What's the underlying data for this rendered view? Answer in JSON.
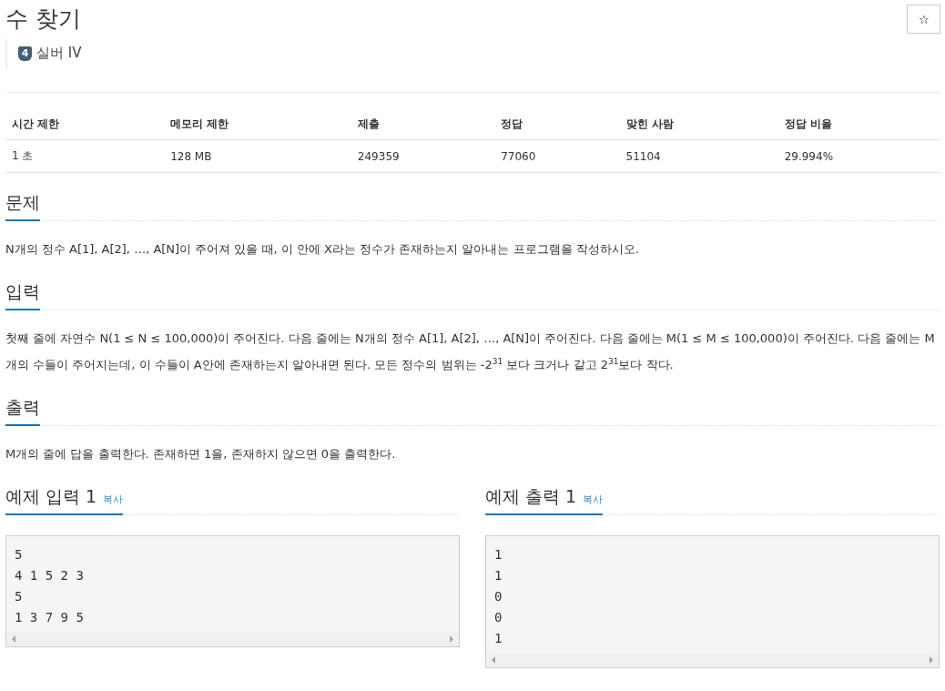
{
  "title": "수 찾기",
  "tier": {
    "number": "4",
    "label": "실버 IV"
  },
  "star_button": {
    "label": "☆"
  },
  "info_table": {
    "columns": [
      "시간 제한",
      "메모리 제한",
      "제출",
      "정답",
      "맞힌 사람",
      "정답 비율"
    ],
    "rows": [
      [
        "1 초",
        "128 MB",
        "249359",
        "77060",
        "51104",
        "29.994%"
      ]
    ]
  },
  "sections": [
    {
      "heading": "문제",
      "text": "N개의 정수 A[1], A[2], …, A[N]이 주어져 있을 때, 이 안에 X라는 정수가 존재하는지 알아내는 프로그램을 작성하시오."
    },
    {
      "heading": "입력",
      "text": "첫째 줄에 자연수 N(1 ≤ N ≤ 100,000)이 주어진다. 다음 줄에는 N개의 정수 A[1], A[2], …, A[N]이 주어진다. 다음 줄에는 M(1 ≤ M ≤ 100,000)이 주어진다. 다음 줄에는 M개의 수들이 주어지는데, 이 수들이 A안에 존재하는지 알아내면 된다. 모든 정수의 범위는 -2$^{31}$ 보다 크거나 같고 2$^{31}$보다 작다."
    },
    {
      "heading": "출력",
      "text": "M개의 줄에 답을 출력한다. 존재하면 1을, 존재하지 않으면 0을 출력한다."
    }
  ],
  "samples": [
    {
      "heading": "예제 입력 1",
      "copy": "복사",
      "lines": [
        "5",
        "4 1 5 2 3",
        "5",
        "1 3 7 9 5"
      ]
    },
    {
      "heading": "예제 출력 1",
      "copy": "복사",
      "lines": [
        "1",
        "1",
        "0",
        "0",
        "1"
      ]
    }
  ]
}
